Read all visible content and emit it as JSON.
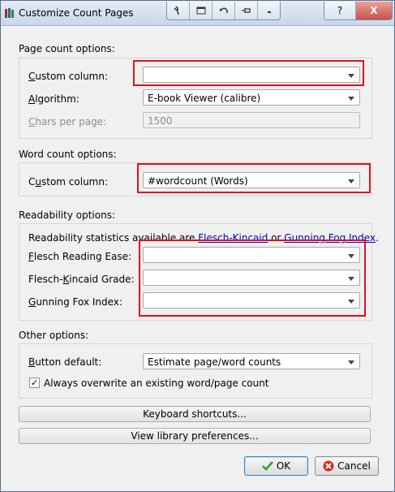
{
  "window": {
    "title": "Customize Count Pages"
  },
  "titlebar": {
    "tools": [
      "wrench-icon",
      "window-icon",
      "undo-icon",
      "pin-icon",
      "dropdown-icon"
    ],
    "help": "?",
    "close": "X"
  },
  "page_count": {
    "section": "Page count options:",
    "custom_column_label": "Custom column:",
    "custom_column_value": "",
    "algorithm_label": "Algorithm:",
    "algorithm_value": "E-book Viewer (calibre)",
    "chars_label": "Chars per page:",
    "chars_value": "1500"
  },
  "word_count": {
    "section": "Word count options:",
    "custom_column_label": "Custom column:",
    "custom_column_value": "#wordcount (Words)"
  },
  "readability": {
    "section": "Readability options:",
    "intro_text": "Readability statistics available are ",
    "link1": "Flesch-Kincaid",
    "or_text": " or ",
    "link2": "Gunning Fog Index",
    "period": ".",
    "flesch_ease_label": "Flesch Reading Ease:",
    "flesch_ease_value": "",
    "flesch_grade_label": "Flesch-Kincaid Grade:",
    "flesch_grade_value": "",
    "gunning_label": "Gunning Fox Index:",
    "gunning_value": ""
  },
  "other": {
    "section": "Other options:",
    "button_default_label": "Button default:",
    "button_default_value": "Estimate page/word counts",
    "overwrite_label": "Always overwrite an existing word/page count",
    "overwrite_checked": true
  },
  "buttons": {
    "keyboard": "Keyboard shortcuts...",
    "library": "View library preferences...",
    "ok": "OK",
    "cancel": "Cancel"
  },
  "colors": {
    "highlight": "#e0101c",
    "link": "#0000cc"
  }
}
